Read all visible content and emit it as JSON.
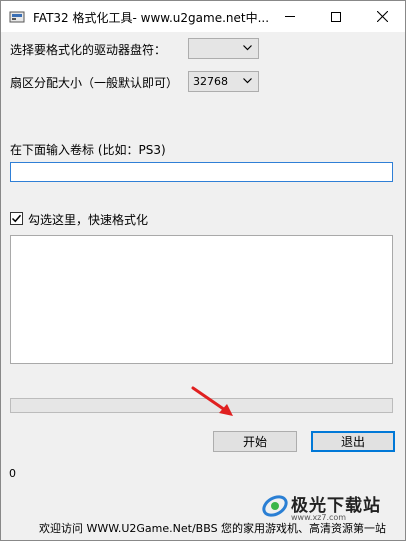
{
  "window": {
    "title": "FAT32 格式化工具- www.u2game.net中..."
  },
  "form": {
    "drive_label": "选择要格式化的驱动器盘符：",
    "drive_value": "",
    "sector_label": "扇区分配大小（一般默认即可）",
    "sector_value": "32768",
    "volume_label": "在下面输入卷标 (比如：PS3)",
    "volume_value": "",
    "quick_format_label": "勾选这里，快速格式化",
    "quick_format_checked": true,
    "log_text": ""
  },
  "progress": {
    "value": 0
  },
  "buttons": {
    "start": "开始",
    "exit": "退出"
  },
  "status": {
    "value": "0"
  },
  "footer": {
    "text": "欢迎访问 WWW.U2Game.Net/BBS 您的家用游戏机、高清资源第一站"
  },
  "watermark": {
    "brand": "极光下载站",
    "url": "www.xz7.com"
  },
  "icons": {
    "app": "app-icon",
    "minimize": "minimize-icon",
    "maximize": "maximize-icon",
    "close": "close-icon",
    "dropdown": "chevron-down-icon",
    "check": "check-icon",
    "annotation": "red-arrow-icon",
    "brand_logo": "aurora-logo-icon"
  },
  "colors": {
    "progress_fill": "#06b025",
    "focus_border": "#0078d7",
    "annotation_arrow": "#e02020"
  }
}
